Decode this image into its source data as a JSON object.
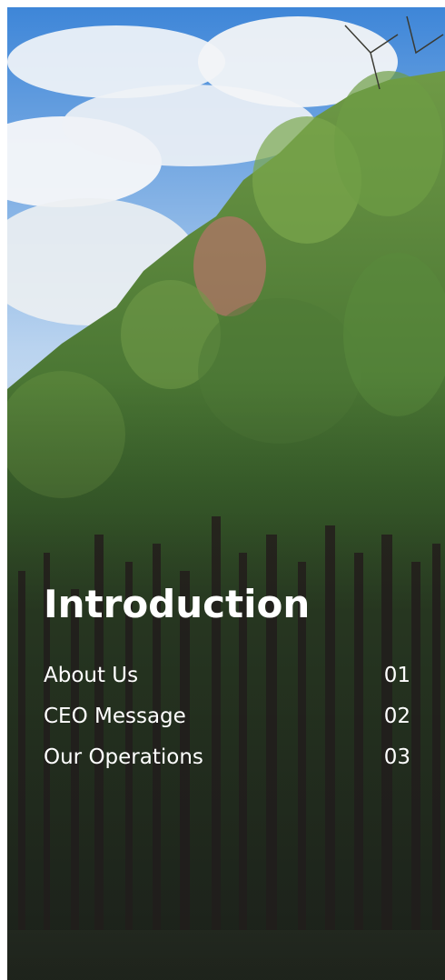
{
  "intro": {
    "title": "Introduction",
    "items": [
      {
        "label": "About Us",
        "number": "01"
      },
      {
        "label": "CEO Message",
        "number": "02"
      },
      {
        "label": "Our Operations",
        "number": "03"
      }
    ]
  },
  "colors": {
    "text": "#ffffff",
    "sky": "#2f7fd4",
    "foliage": "#5f8f3c",
    "trunk": "#2b241f"
  }
}
